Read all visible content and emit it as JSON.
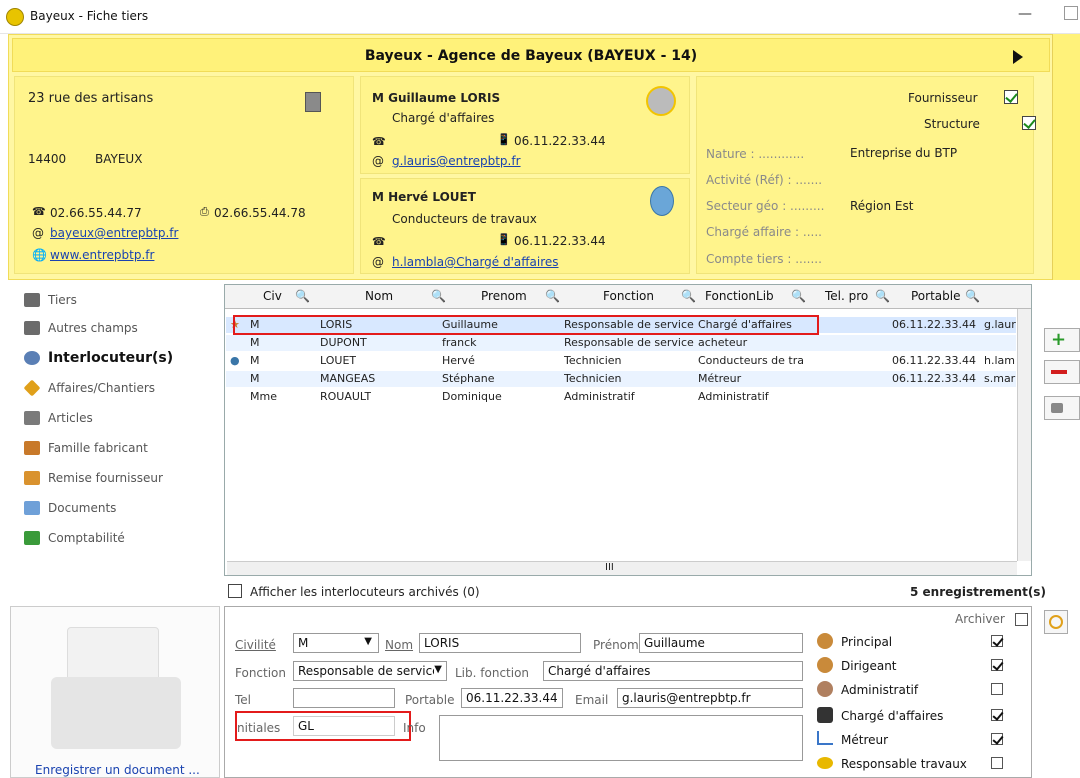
{
  "window": {
    "title": "Bayeux - Fiche tiers",
    "min_glyph": "—"
  },
  "agency": {
    "title": "Bayeux - Agence de Bayeux (BAYEUX - 14)"
  },
  "address": {
    "street": "23 rue des artisans",
    "postcode": "14400",
    "city": "BAYEUX",
    "phone": "02.66.55.44.77",
    "fax": "02.66.55.44.78",
    "email": "bayeux@entrepbtp.fr",
    "website": "www.entrepbtp.fr"
  },
  "contact1": {
    "name": "M Guillaume LORIS",
    "role": "Chargé d'affaires",
    "mobile": "06.11.22.33.44",
    "email": "g.lauris@entrepbtp.fr"
  },
  "contact2": {
    "name": "M Hervé LOUET",
    "role": "Conducteurs de travaux",
    "mobile": "06.11.22.33.44",
    "email": "h.lambla@Chargé d'affaires"
  },
  "props": {
    "fournisseur": "Fournisseur",
    "structure": "Structure",
    "nature_label": "Nature : ............",
    "nature_value": "Entreprise du BTP",
    "activite_label": "Activité (Réf) : .......",
    "secteur_label": "Secteur géo : .........",
    "secteur_value": "Région Est",
    "charge_label": "Chargé affaire : .....",
    "compte_label": "Compte tiers : ......."
  },
  "nav": {
    "items": [
      {
        "label": "Tiers",
        "color": "#6b6b6b"
      },
      {
        "label": "Autres champs",
        "color": "#6b6b6b"
      },
      {
        "label": "Interlocuteur(s)",
        "color": "#5a7fb5"
      },
      {
        "label": "Affaires/Chantiers",
        "color": "#e0a01a"
      },
      {
        "label": "Articles",
        "color": "#7a7a7a"
      },
      {
        "label": "Famille fabricant",
        "color": "#c8792a"
      },
      {
        "label": "Remise fournisseur",
        "color": "#d9922e"
      },
      {
        "label": "Documents",
        "color": "#6fa0d8"
      },
      {
        "label": "Comptabilité",
        "color": "#3a9a3a"
      }
    ]
  },
  "grid": {
    "headers": [
      "Civ",
      "Nom",
      "Prenom",
      "Fonction",
      "FonctionLib",
      "Tel. pro",
      "Portable"
    ],
    "rows": [
      {
        "civ": "M",
        "nom": "LORIS",
        "prenom": "Guillaume",
        "fonction": "Responsable de service",
        "lib": "Chargé d'affaires",
        "tel": "",
        "portable": "06.11.22.33.44",
        "email": "g.laur"
      },
      {
        "civ": "M",
        "nom": "DUPONT",
        "prenom": "franck",
        "fonction": "Responsable de service",
        "lib": "acheteur",
        "tel": "",
        "portable": "",
        "email": ""
      },
      {
        "civ": "M",
        "nom": "LOUET",
        "prenom": "Hervé",
        "fonction": "Technicien",
        "lib": "Conducteurs de tra",
        "tel": "",
        "portable": "06.11.22.33.44",
        "email": "h.lam"
      },
      {
        "civ": "M",
        "nom": "MANGEAS",
        "prenom": "Stéphane",
        "fonction": "Technicien",
        "lib": "Métreur",
        "tel": "",
        "portable": "06.11.22.33.44",
        "email": "s.mar"
      },
      {
        "civ": "Mme",
        "nom": "ROUAULT",
        "prenom": "Dominique",
        "fonction": "Administratif",
        "lib": "Administratif",
        "tel": "",
        "portable": "",
        "email": ""
      }
    ],
    "scroll_mid": "III",
    "archived_label": "Afficher les interlocuteurs archivés (0)",
    "count_label": "5 enregistrement(s)"
  },
  "form": {
    "archiver": "Archiver",
    "civilite_label": "Civilité",
    "civilite_value": "M",
    "nom_label": "Nom",
    "nom_value": "LORIS",
    "prenom_label": "Prénom",
    "prenom_value": "Guillaume",
    "fonction_label": "Fonction",
    "fonction_value": "Responsable de service",
    "lib_label": "Lib. fonction",
    "lib_value": "Chargé d'affaires",
    "tel_label": "Tel",
    "tel_value": "",
    "portable_label": "Portable",
    "portable_value": "06.11.22.33.44",
    "email_label": "Email",
    "email_value": "g.lauris@entrepbtp.fr",
    "initiales_label": "nitiales",
    "initiales_value": "GL",
    "info_label": "Info",
    "roles": [
      {
        "label": "Principal",
        "checked": true
      },
      {
        "label": "Dirigeant",
        "checked": true
      },
      {
        "label": "Administratif",
        "checked": false
      },
      {
        "label": "Chargé d'affaires",
        "checked": true
      },
      {
        "label": "Métreur",
        "checked": true
      },
      {
        "label": "Responsable travaux",
        "checked": false
      }
    ]
  },
  "docpanel": {
    "link": "Enregistrer un document ..."
  }
}
